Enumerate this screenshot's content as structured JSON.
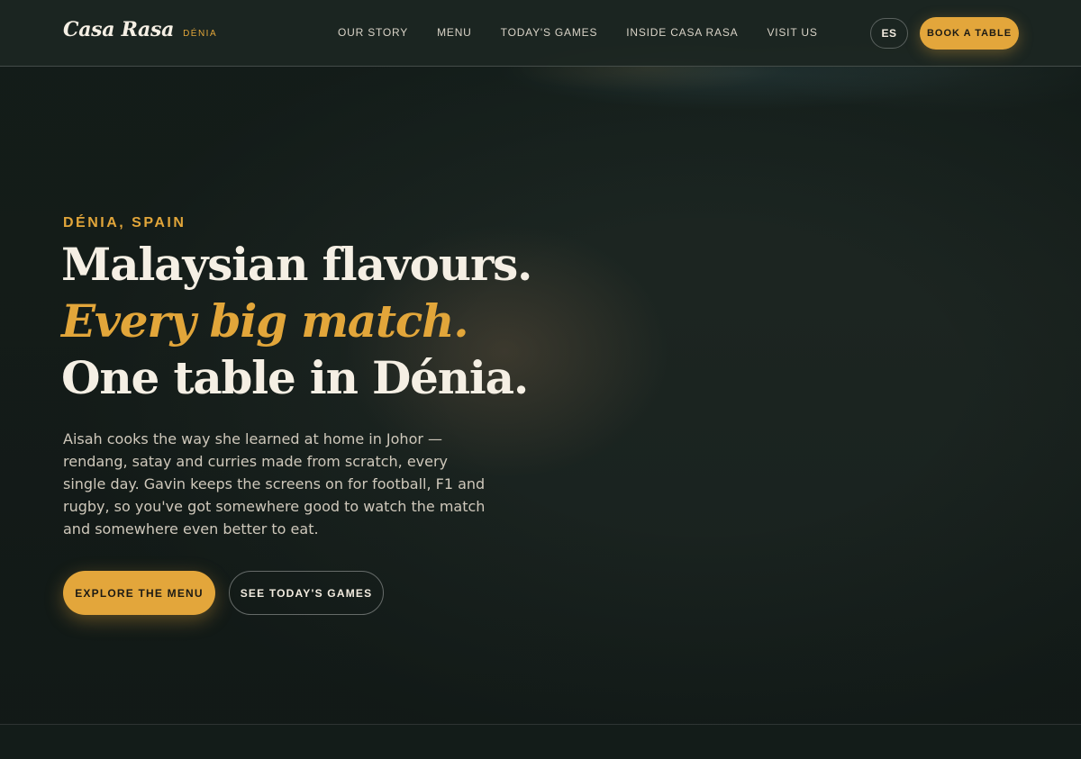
{
  "header": {
    "brand_name": "Casa Rasa",
    "brand_location": "DÉNIA",
    "nav": [
      {
        "label": "OUR STORY"
      },
      {
        "label": "MENU"
      },
      {
        "label": "TODAY'S GAMES"
      },
      {
        "label": "INSIDE CASA RASA"
      },
      {
        "label": "VISIT US"
      }
    ],
    "language_label": "ES",
    "book_label": "BOOK A TABLE"
  },
  "hero": {
    "eyebrow": "DÉNIA, SPAIN",
    "headline_line1": "Malaysian flavours.",
    "headline_line2": "Every big match.",
    "headline_line3": "One table in Dénia.",
    "intro": "Aisah cooks the way she learned at home in Johor — rendang, satay and curries made from scratch, every single day. Gavin keeps the screens on for football, F1 and rugby, so you've got somewhere good to watch the match and somewhere even better to eat.",
    "primary_cta": "EXPLORE THE MENU",
    "secondary_cta": "SEE TODAY'S GAMES"
  },
  "colors": {
    "accent": "#e3a63b",
    "background": "#16201d",
    "text": "#f5efe4"
  }
}
